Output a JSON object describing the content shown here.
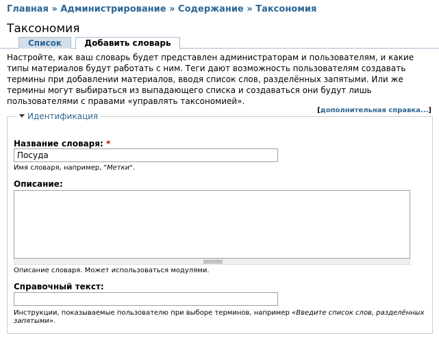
{
  "breadcrumb": {
    "items": [
      "Главная",
      "Администрирование",
      "Содержание",
      "Таксономия"
    ],
    "separator": "»"
  },
  "page": {
    "title": "Таксономия"
  },
  "tabs": [
    {
      "label": "Список",
      "active": false
    },
    {
      "label": "Добавить словарь",
      "active": true
    }
  ],
  "intro": "Настройте, как ваш словарь будет представлен администраторам и пользователям, и какие типы материалов будут работать с ним. Теги дают возможность пользователям создавать термины при добавлении материалов, вводя список слов, разделённых запятыми. Или же термины могут выбираться из выпадающего списка и создаваться они будут лишь пользователями с правами «управлять таксономией».",
  "help": {
    "open_bracket": "[",
    "link": "дополнительная справка...",
    "close_bracket": "]"
  },
  "fieldset": {
    "legend": "Идентификация",
    "name": {
      "label": "Название словаря:",
      "required_mark": "*",
      "value": "Посуда",
      "description_prefix": "Имя словаря, например, ",
      "description_example": "\"Метки\"",
      "description_suffix": "."
    },
    "description": {
      "label": "Описание:",
      "value": "",
      "description": "Описание словаря. Может использоваться модулями."
    },
    "help_text": {
      "label": "Справочный текст:",
      "value": "",
      "description_prefix": "Инструкции, показываемые пользователю при выборе терминов, например ",
      "description_example": "«Введите список слов, разделённых запятыми»",
      "description_suffix": "."
    }
  },
  "colors": {
    "link": "#2b6594",
    "tab_inactive_bg": "#d4dfe9",
    "required": "#cc0000"
  }
}
